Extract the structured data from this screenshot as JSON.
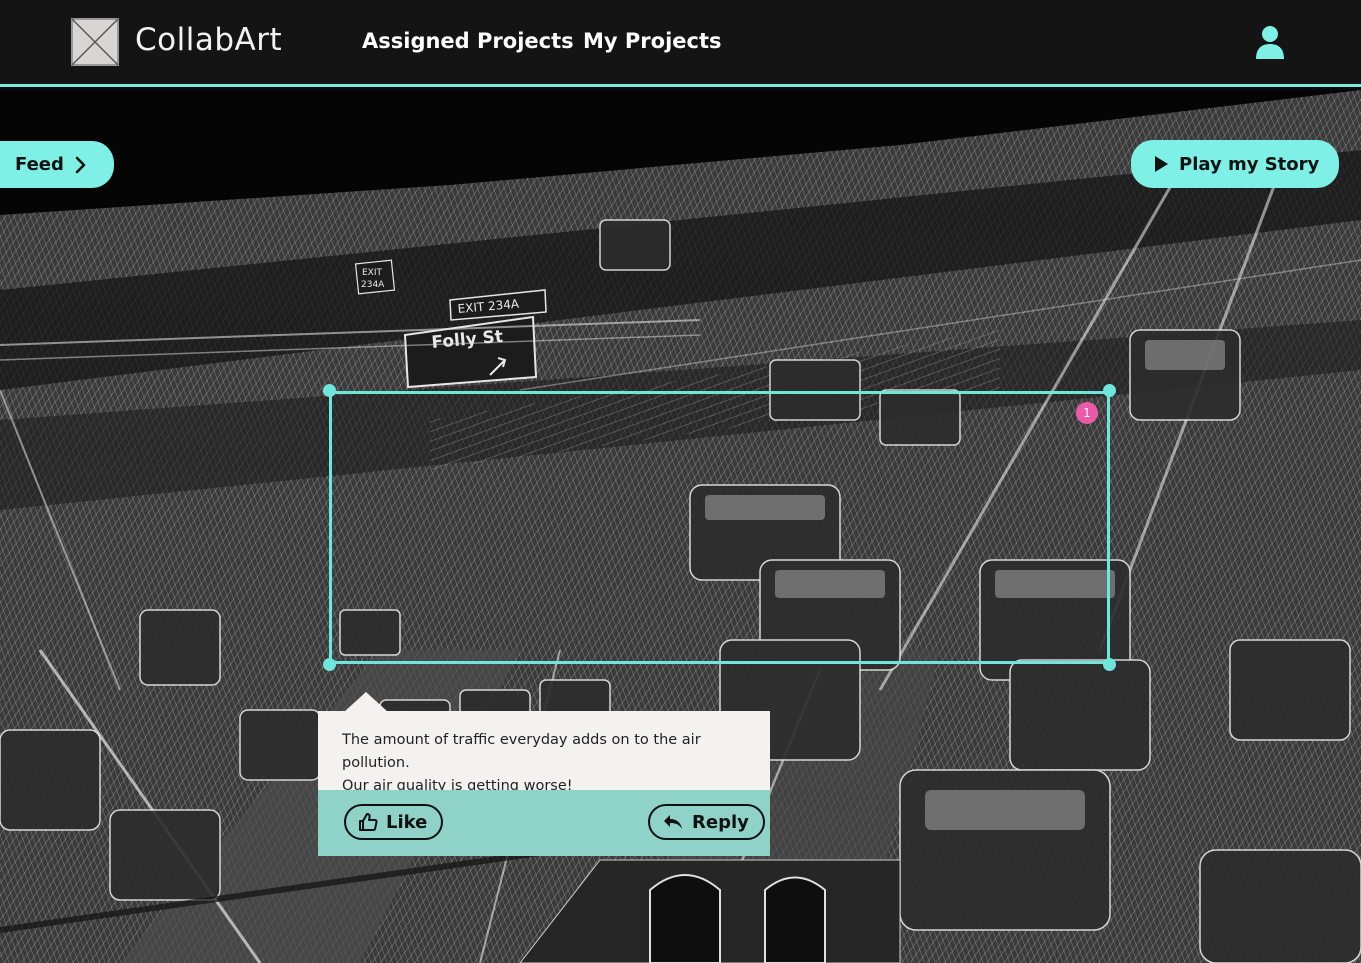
{
  "header": {
    "brand": "CollabArt",
    "nav": [
      {
        "label": "Assigned Projects"
      },
      {
        "label": "My Projects"
      }
    ]
  },
  "actions": {
    "feed_label": "Feed",
    "play_label": "Play my Story"
  },
  "annotation": {
    "marker_number": "1"
  },
  "comment": {
    "text_line1": "The amount of traffic everyday adds on to the air pollution.",
    "text_line2": "Our air quality is getting worse!",
    "like_label": "Like",
    "reply_label": "Reply"
  },
  "artwork": {
    "sign_main": "Folly St",
    "sign_exit": "EXIT 234A",
    "sign_small_1": "EXIT",
    "sign_small_2": "234A"
  },
  "colors": {
    "accent": "#7ef0e6",
    "selection": "#6ee6dc",
    "marker": "#ea5aa8",
    "comment_bg": "#f4f2ee",
    "comment_actions_bg": "#8ed2c8",
    "topbar_bg": "#141414"
  },
  "icons": {
    "logo": "placeholder-image-icon",
    "user": "user-icon",
    "feed": "chevron-right-icon",
    "play": "play-icon",
    "like": "thumbs-up-icon",
    "reply": "reply-arrow-icon"
  }
}
